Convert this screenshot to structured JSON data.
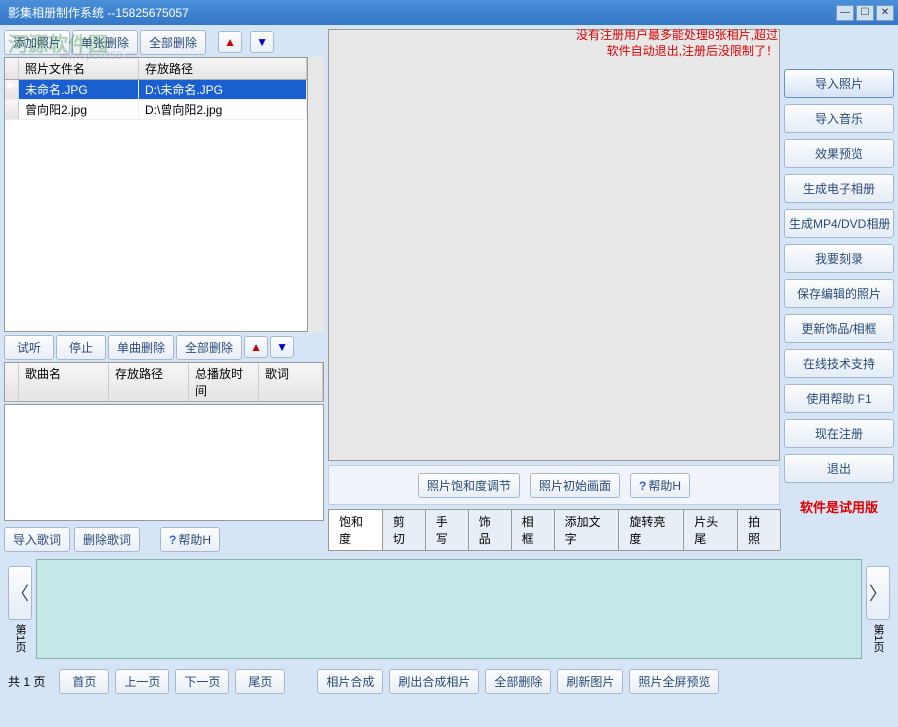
{
  "title": "影集相册制作系统    --15825675057",
  "notice_line1": "没有注册用户最多能处理8张相片,超过",
  "notice_line2": "软件自动退出,注册后没限制了！",
  "photo_toolbar": {
    "add": "添加照片",
    "del_one": "单张删除",
    "del_all": "全部删除"
  },
  "photo_grid": {
    "cols": [
      "照片文件名",
      "存放路径"
    ],
    "rows": [
      {
        "name": "未命名.JPG",
        "path": "D:\\未命名.JPG",
        "selected": true
      },
      {
        "name": "曾向阳2.jpg",
        "path": "D:\\曾向阳2.jpg",
        "selected": false
      }
    ]
  },
  "song_toolbar": {
    "preview": "试听",
    "stop": "停止",
    "del_one": "单曲删除",
    "del_all": "全部删除"
  },
  "song_grid": {
    "cols": [
      "歌曲名",
      "存放路径",
      "总播放时间",
      "歌词"
    ]
  },
  "lyrics_toolbar": {
    "import": "导入歌词",
    "delete": "删除歌词",
    "help": "帮助H"
  },
  "preview_toolbar": {
    "saturation": "照片饱和度调节",
    "reset": "照片初始画面",
    "help": "帮助H"
  },
  "tabs": [
    "饱和度",
    "剪切",
    "手写",
    "饰品",
    "相框",
    "添加文字",
    "旋转亮度",
    "片头尾",
    "拍照"
  ],
  "right_buttons": [
    "导入照片",
    "导入音乐",
    "效果预览",
    "生成电子相册",
    "生成MP4/DVD相册",
    "我要刻录",
    "保存编辑的照片",
    "更新饰品/相框",
    "在线技术支持",
    "使用帮助   F1",
    "现在注册",
    "退出"
  ],
  "trial_note": "软件是试用版",
  "pager": {
    "left_label": "第1页",
    "right_label": "第1页"
  },
  "footer": {
    "page_info": "共 1 页",
    "buttons": [
      "首页",
      "上一页",
      "下一页",
      "尾页",
      "相片合成",
      "刷出合成相片",
      "全部删除",
      "刷新图片",
      "照片全屏预览"
    ]
  },
  "watermark": "河源软件园",
  "watermark_url": "www.pc0359.cn"
}
